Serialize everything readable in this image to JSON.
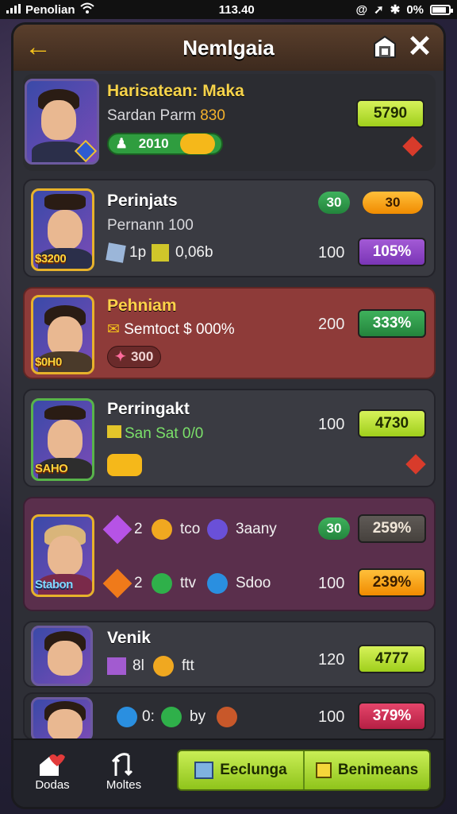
{
  "status": {
    "carrier": "Penolian",
    "time": "113.40",
    "battery": "0%"
  },
  "header": {
    "title": "Nemlgaia"
  },
  "rows": [
    {
      "name": "Harisatean: Maka",
      "sub1": "Sardan Parm",
      "sub1_value": "830",
      "chip_value": "2010",
      "score": "5790"
    },
    {
      "name": "Perinjats",
      "sub1": "Pernann 100",
      "badge1": "30",
      "badge2": "30",
      "item1": "1p",
      "item2": "0,06b",
      "num": "100",
      "score": "105%",
      "tag": "$3200"
    },
    {
      "name": "Pehniam",
      "sub1": "Semtoct $ 000%",
      "chip_value": "300",
      "num": "200",
      "score": "333%",
      "tag": "$0H0"
    },
    {
      "name": "Perringakt",
      "sub1": "San Sat 0/0",
      "num": "100",
      "score": "4730",
      "tag": "SAHO"
    },
    {
      "tag": "Stabon",
      "line1": {
        "n1": "2",
        "t1": "tco",
        "t2": "3aany",
        "badge": "30",
        "score": "259%"
      },
      "line2": {
        "n1": "2",
        "t1": "ttv",
        "t2": "Sdoo",
        "num": "100",
        "score": "239%"
      }
    },
    {
      "name": "Venik",
      "n1": "8l",
      "t1": "ftt",
      "num": "120",
      "score": "4777"
    },
    {
      "t0": "0:",
      "t1": "by",
      "num": "100",
      "score": "379%"
    }
  ],
  "nav": {
    "left_label": "Dodas",
    "right_label": "Moltes",
    "action1": "Eeclunga",
    "action2": "Benimeans"
  },
  "colors": {
    "accent": "#f5c21b",
    "lime": "#b6e030"
  },
  "progress": {
    "battery_fraction": 0.85
  }
}
